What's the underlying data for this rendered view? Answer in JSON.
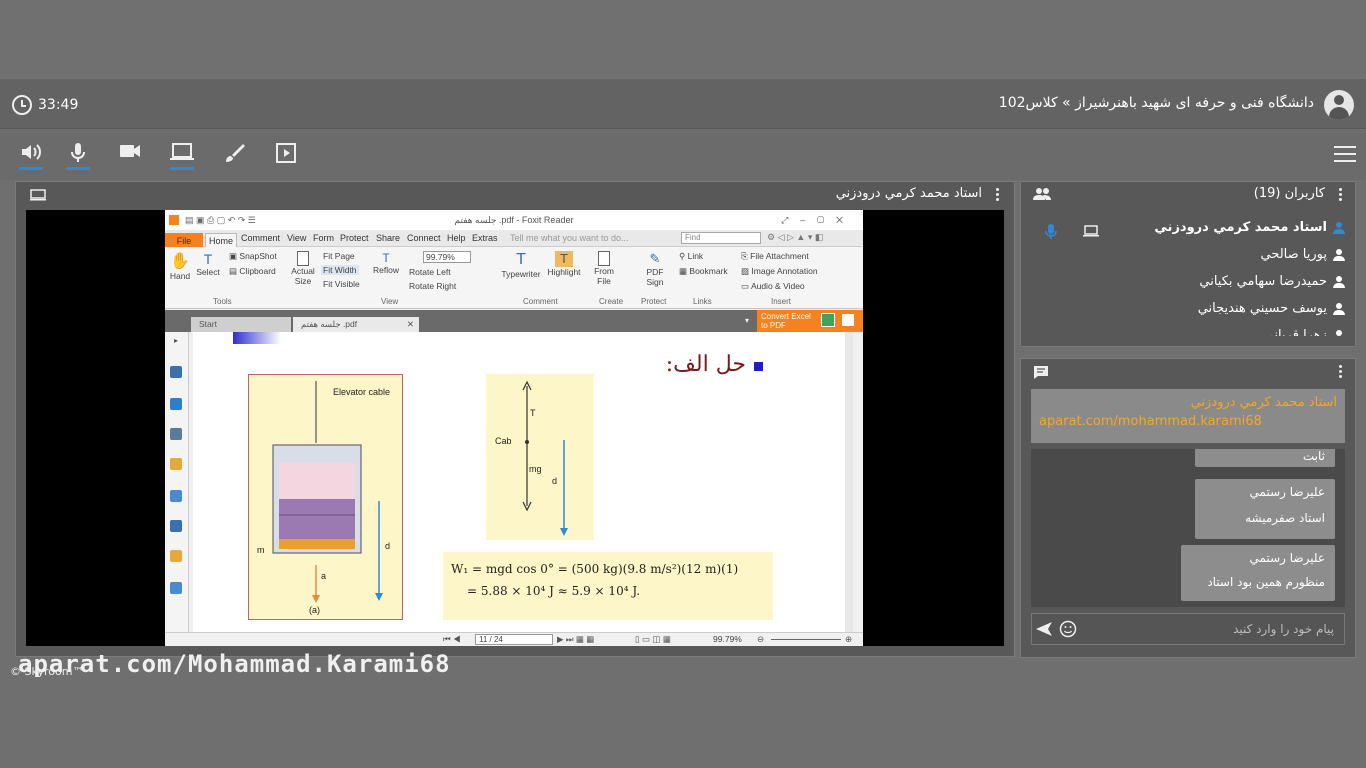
{
  "header": {
    "title": "دانشگاه فنی و حرفه ای شهید باهنرشیراز » کلاس102",
    "timer": "33:49"
  },
  "toolbar": {
    "icons": [
      "speaker-icon",
      "microphone-icon",
      "camera-icon",
      "screen-share-icon",
      "brush-icon",
      "presentation-icon"
    ],
    "active_color": "#2e8ad8"
  },
  "presenter": {
    "name": "استاد محمد کرمي درودزني"
  },
  "foxit": {
    "title": "جلسه هفتم .pdf - Foxit Reader",
    "tabs": [
      "File",
      "Home",
      "Comment",
      "View",
      "Form",
      "Protect",
      "Share",
      "Connect",
      "Help",
      "Extras"
    ],
    "tell_me": "Tell me what you want to do...",
    "find_placeholder": "Find",
    "tools": {
      "hand": "Hand",
      "select": "Select",
      "snapshot": "SnapShot",
      "clipboard": "Clipboard",
      "actual_size": "Actual Size",
      "fit_page": "Fit Page",
      "fit_width": "Fit Width",
      "fit_visible": "Fit Visible",
      "reflow": "Reflow",
      "zoom": "99.79%",
      "rotate_left": "Rotate Left",
      "rotate_right": "Rotate Right",
      "typewriter": "Typewriter",
      "highlight": "Highlight",
      "from_file": "From File",
      "pdf_sign": "PDF Sign",
      "link": "Link",
      "bookmark": "Bookmark",
      "file_attachment": "File Attachment",
      "image_annotation": "Image Annotation",
      "audio_video": "Audio & Video"
    },
    "groups": [
      "Tools",
      "View",
      "Comment",
      "Create",
      "Protect",
      "Links",
      "Insert"
    ],
    "doc_tabs": [
      "Start",
      "جلسه هفتم .pdf"
    ],
    "convert_label": "Convert Excel to PDF",
    "status": {
      "page": "11 / 24",
      "zoom": "99.79%"
    }
  },
  "slide": {
    "heading": "حل الف:",
    "elevator_cable": "Elevator cable",
    "label_m": "m",
    "label_a": "a",
    "label_d": "d",
    "caption": "(a)",
    "fbd_T": "T",
    "fbd_cab": "Cab",
    "fbd_mg": "mg",
    "fbd_d": "d",
    "eq_line1": "W₁ = mgd cos 0° = (500 kg)(9.8 m/s²)(12 m)(1)",
    "eq_line2": "= 5.88 × 10⁴ J ≈ 5.9 × 10⁴ J."
  },
  "users_panel": {
    "title": "کاربران (19)",
    "users": [
      "استاد محمد کرمي درودزني",
      "پوريا صالحي",
      "حميدرضا سهامي بکياني",
      "يوسف حسيني هنديجاني",
      "زهرا قربانی"
    ],
    "highlight_color": "#2e8ad8"
  },
  "chat_panel": {
    "pinned_name": "استاد محمد کرمي درودزني",
    "pinned_link": "aparat.com/mohammad.karami68",
    "pinned_name_color": "#f5a623",
    "messages": [
      {
        "sender": "",
        "text": "ثابت"
      },
      {
        "sender": "عليرضا رستمي",
        "text": "استاد صفرميشه"
      },
      {
        "sender": "عليرضا رستمي",
        "text": "منظورم همين بود استاد"
      }
    ],
    "input_placeholder": "پيام خود را وارد کنيد"
  },
  "watermark": "aparat.com/Mohammad.Karami68",
  "brand": "© Skyroom™"
}
